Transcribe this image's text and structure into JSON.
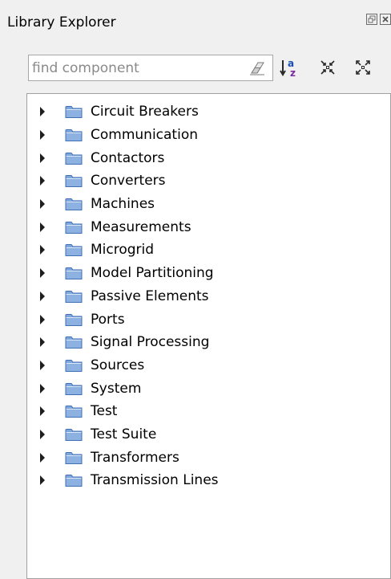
{
  "panel": {
    "title": "Library Explorer"
  },
  "search": {
    "placeholder": "find component",
    "value": ""
  },
  "toolbar": {
    "sort_label": "a",
    "sort_label_2": "z"
  },
  "tree": {
    "items": [
      {
        "label": "Circuit Breakers",
        "icon": "folder-icon"
      },
      {
        "label": "Communication",
        "icon": "folder-icon"
      },
      {
        "label": "Contactors",
        "icon": "folder-icon"
      },
      {
        "label": "Converters",
        "icon": "folder-icon"
      },
      {
        "label": "Machines",
        "icon": "folder-icon"
      },
      {
        "label": "Measurements",
        "icon": "folder-icon"
      },
      {
        "label": "Microgrid",
        "icon": "folder-icon"
      },
      {
        "label": "Model Partitioning",
        "icon": "folder-icon"
      },
      {
        "label": "Passive Elements",
        "icon": "folder-icon"
      },
      {
        "label": "Ports",
        "icon": "folder-icon"
      },
      {
        "label": "Signal Processing",
        "icon": "folder-icon"
      },
      {
        "label": "Sources",
        "icon": "folder-icon"
      },
      {
        "label": "System",
        "icon": "folder-icon"
      },
      {
        "label": "Test",
        "icon": "folder-icon"
      },
      {
        "label": "Test Suite",
        "icon": "folder-icon"
      },
      {
        "label": "Transformers",
        "icon": "folder-icon"
      },
      {
        "label": "Transmission Lines",
        "icon": "folder-icon"
      }
    ]
  },
  "colors": {
    "panel_bg": "#f0f0f0",
    "folder_fill": "#7fa7dc",
    "folder_stroke": "#3f6fb4",
    "sort_a": "#1c4fb0",
    "sort_z": "#7a2a9a"
  }
}
